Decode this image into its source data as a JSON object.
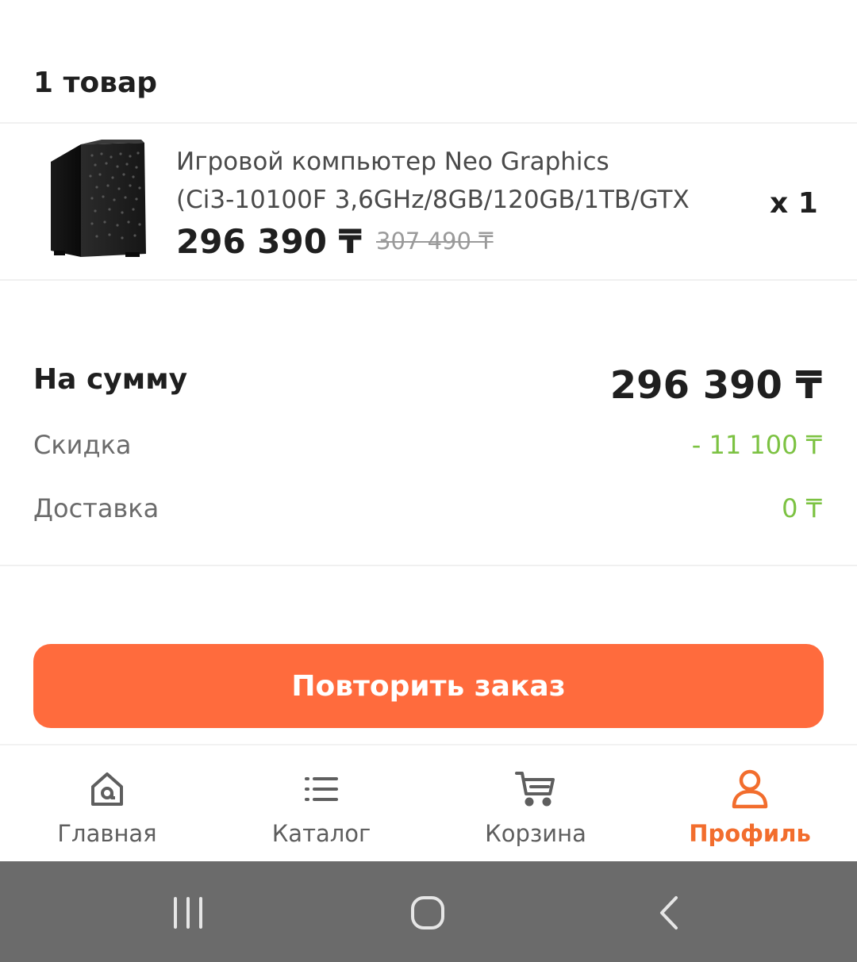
{
  "order": {
    "items_title": "1 товар"
  },
  "product": {
    "name_line1": "Игровой компьютер Neo Graphics",
    "name_line2": "(Ci3-10100F 3,6GHz/8GB/120GB/1TB/GTX",
    "price": "296 390 ₸",
    "old_price": "307 490 ₸",
    "quantity": "x 1",
    "image": "pc-case-image"
  },
  "summary": {
    "sum_label": "На сумму",
    "sum_value": "296 390 ₸",
    "discount_label": "Скидка",
    "discount_value": "- 11 100 ₸",
    "delivery_label": "Доставка",
    "delivery_value": "0 ₸"
  },
  "actions": {
    "repeat_label": "Повторить заказ"
  },
  "nav": {
    "items": [
      {
        "label": "Главная",
        "icon": "home-icon",
        "active": false
      },
      {
        "label": "Каталог",
        "icon": "list-icon",
        "active": false
      },
      {
        "label": "Корзина",
        "icon": "cart-icon",
        "active": false
      },
      {
        "label": "Профиль",
        "icon": "profile-icon",
        "active": true
      }
    ]
  },
  "colors": {
    "accent": "#ff6b3d",
    "active_nav": "#f26d2d",
    "discount_green": "#7cc242",
    "system_bar": "#6b6b6b"
  },
  "system_nav": {
    "icons": [
      "recent-apps-icon",
      "home-button-icon",
      "back-icon"
    ]
  }
}
